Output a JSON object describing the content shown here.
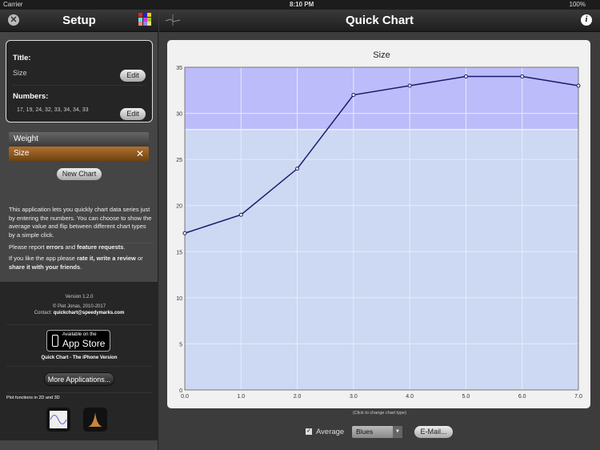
{
  "status": {
    "carrier": "Carrier",
    "time": "8:10 PM",
    "battery": "100%"
  },
  "setup": {
    "title": "Setup",
    "title_label": "Title:",
    "title_value": "Size",
    "edit": "Edit",
    "numbers_label": "Numbers:",
    "numbers_value": "17, 19, 24, 32, 33, 34, 34, 33",
    "charts": [
      {
        "label": "Weight"
      },
      {
        "label": "Size"
      }
    ],
    "new_chart": "New Chart",
    "info1": "This application lets you quickly chart data series just by entering the numbers. You can choose to show the average value and flip between different chart types by a simple click.",
    "report_pre": "Please report ",
    "errors": "errors",
    "and": " and ",
    "feature": "feature requests",
    "dot": ".",
    "like_pre": "If you like the app please ",
    "rate": "rate it, write a review",
    "or": " or ",
    "share": "share it with your friends",
    "version": "Version 1.2.0",
    "copyright": "© Piet Jonas, 2010-2017",
    "contact_pre": "Contact: ",
    "contact_email": "quickchart@speedymarks.com",
    "appstore_small": "Available on the",
    "appstore_big": "App Store",
    "iphone_version": "Quick Chart - The iPhone Version",
    "more_apps": "More Applications...",
    "plot_functions": "Plot functions in 2D and 3D"
  },
  "main": {
    "title": "Quick Chart",
    "hint": "(Click to change chart type)",
    "average_label": "Average",
    "average_checked": true,
    "palette": "Blues",
    "email": "E-Mail..."
  },
  "chart_data": {
    "type": "line",
    "title": "Size",
    "x": [
      0,
      1,
      2,
      3,
      4,
      5,
      6,
      7
    ],
    "values": [
      17,
      19,
      24,
      32,
      33,
      34,
      34,
      33
    ],
    "average": 28.25,
    "xticks": [
      "0.0",
      "1.0",
      "2.0",
      "3.0",
      "4.0",
      "5.0",
      "6.0",
      "7.0"
    ],
    "yticks": [
      "0",
      "5",
      "10",
      "15",
      "20",
      "25",
      "30",
      "35"
    ],
    "ylim": [
      0,
      35
    ],
    "xlim": [
      0,
      7
    ],
    "grid": true
  }
}
